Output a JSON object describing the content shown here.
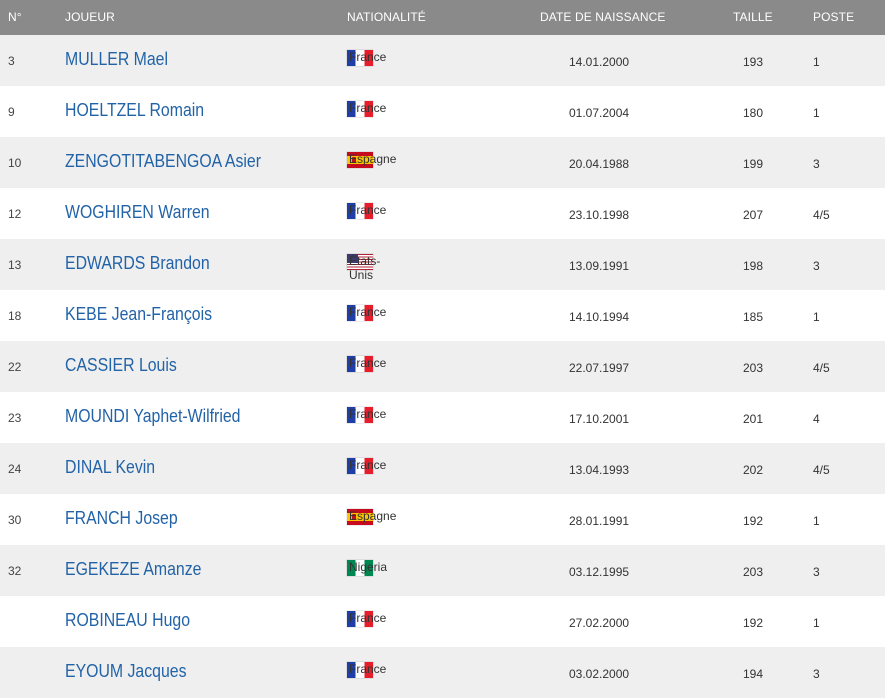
{
  "header": {
    "num": "N°",
    "player": "JOUEUR",
    "nationality": "NATIONALITÉ",
    "birthdate": "DATE DE NAISSANCE",
    "height": "TAILLE",
    "position": "POSTE"
  },
  "colors": {
    "header_bg": "#8a8a8a",
    "row_alt_bg": "#efefef",
    "player_link": "#2263a8"
  },
  "players": [
    {
      "num": "3",
      "name": "MULLER Mael",
      "flag": "france-flag-icon",
      "nationality": "France",
      "birthdate": "14.01.2000",
      "height": "193",
      "position": "1"
    },
    {
      "num": "9",
      "name": "HOELTZEL Romain",
      "flag": "france-flag-icon",
      "nationality": "France",
      "birthdate": "01.07.2004",
      "height": "180",
      "position": "1"
    },
    {
      "num": "10",
      "name": "ZENGOTITABENGOA Asier",
      "flag": "spain-flag-icon",
      "nationality": "Espagne",
      "birthdate": "20.04.1988",
      "height": "199",
      "position": "3"
    },
    {
      "num": "12",
      "name": "WOGHIREN Warren",
      "flag": "france-flag-icon",
      "nationality": "France",
      "birthdate": "23.10.1998",
      "height": "207",
      "position": "4/5"
    },
    {
      "num": "13",
      "name": "EDWARDS Brandon",
      "flag": "united-states-flag-icon",
      "nationality": "États-Unis",
      "birthdate": "13.09.1991",
      "height": "198",
      "position": "3"
    },
    {
      "num": "18",
      "name": "KEBE Jean-François",
      "flag": "france-flag-icon",
      "nationality": "France",
      "birthdate": "14.10.1994",
      "height": "185",
      "position": "1"
    },
    {
      "num": "22",
      "name": "CASSIER Louis",
      "flag": "france-flag-icon",
      "nationality": "France",
      "birthdate": "22.07.1997",
      "height": "203",
      "position": "4/5"
    },
    {
      "num": "23",
      "name": "MOUNDI Yaphet-Wilfried",
      "flag": "france-flag-icon",
      "nationality": "France",
      "birthdate": "17.10.2001",
      "height": "201",
      "position": "4"
    },
    {
      "num": "24",
      "name": "DINAL Kevin",
      "flag": "france-flag-icon",
      "nationality": "France",
      "birthdate": "13.04.1993",
      "height": "202",
      "position": "4/5"
    },
    {
      "num": "30",
      "name": "FRANCH Josep",
      "flag": "spain-flag-icon",
      "nationality": "Espagne",
      "birthdate": "28.01.1991",
      "height": "192",
      "position": "1"
    },
    {
      "num": "32",
      "name": "EGEKEZE Amanze",
      "flag": "nigeria-flag-icon",
      "nationality": "Nigeria",
      "birthdate": "03.12.1995",
      "height": "203",
      "position": "3"
    },
    {
      "num": "",
      "name": "ROBINEAU Hugo",
      "flag": "france-flag-icon",
      "nationality": "France",
      "birthdate": "27.02.2000",
      "height": "192",
      "position": "1"
    },
    {
      "num": "",
      "name": "EYOUM Jacques",
      "flag": "france-flag-icon",
      "nationality": "France",
      "birthdate": "03.02.2000",
      "height": "194",
      "position": "3"
    }
  ]
}
